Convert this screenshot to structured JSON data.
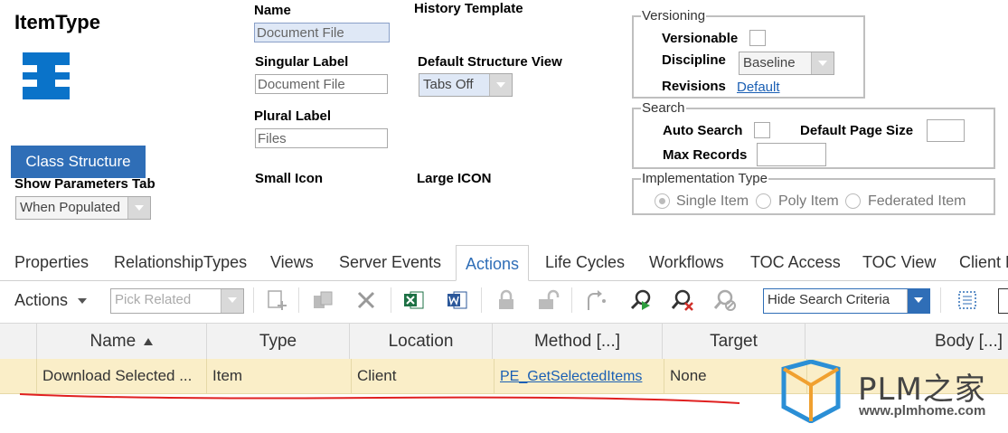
{
  "header": {
    "title": "ItemType"
  },
  "form": {
    "name_label": "Name",
    "name_value": "Document File",
    "history_template_label": "History Template",
    "singular_label": "Singular Label",
    "singular_value": "Document File",
    "default_structure_view_label": "Default Structure View",
    "default_structure_view_value": "Tabs Off",
    "plural_label": "Plural Label",
    "plural_value": "Files",
    "small_icon_label": "Small Icon",
    "large_icon_label": "Large ICON",
    "class_structure_button": "Class Structure",
    "show_parameters_tab_label": "Show Parameters Tab",
    "show_parameters_tab_value": "When Populated"
  },
  "versioning": {
    "legend": "Versioning",
    "versionable_label": "Versionable",
    "discipline_label": "Discipline",
    "discipline_value": "Baseline",
    "revisions_label": "Revisions",
    "revisions_link": "Default"
  },
  "search": {
    "legend": "Search",
    "auto_search_label": "Auto Search",
    "default_page_size_label": "Default Page Size",
    "max_records_label": "Max Records"
  },
  "implementation": {
    "legend": "Implementation Type",
    "options": [
      "Single Item",
      "Poly Item",
      "Federated Item"
    ],
    "selected": "Single Item"
  },
  "tabs": [
    "Properties",
    "RelationshipTypes",
    "Views",
    "Server Events",
    "Actions",
    "Life Cycles",
    "Workflows",
    "TOC Access",
    "TOC View",
    "Client E"
  ],
  "active_tab": "Actions",
  "toolbar": {
    "actions_label": "Actions",
    "pick_related_placeholder": "Pick Related",
    "search_mode_value": "Hide Search Criteria"
  },
  "grid": {
    "columns": [
      "Name",
      "Type",
      "Location",
      "Method [...]",
      "Target",
      "Body [...]"
    ],
    "rows": [
      {
        "name": "Download Selected ...",
        "type": "Item",
        "location": "Client",
        "method": "PE_GetSelectedItems",
        "target": "None",
        "body": ""
      }
    ]
  },
  "watermark": {
    "brand": "PLM之家",
    "url": "www.plmhome.com"
  },
  "colors": {
    "accent": "#2f6eb7",
    "row_highlight": "#faeec8",
    "annotation": "#e02020"
  }
}
